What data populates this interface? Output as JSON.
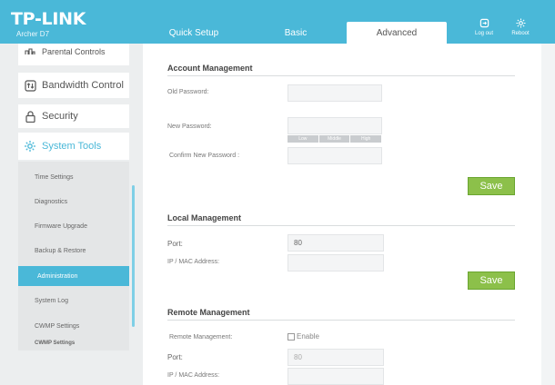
{
  "header": {
    "logo": "TP-LINK",
    "model": "Archer D7",
    "tabs": {
      "quick_setup": "Quick Setup",
      "basic": "Basic",
      "advanced": "Advanced"
    },
    "logout_label": "Log out",
    "reboot_label": "Reboot"
  },
  "sidebar": {
    "parental": "Parental Controls",
    "bandwidth": "Bandwidth Control",
    "security": "Security",
    "system_tools": "System Tools",
    "sub": [
      "Time Settings",
      "Diagnostics",
      "Firmware Upgrade",
      "Backup & Restore",
      "Administration",
      "System Log",
      "CWMP Settings",
      "CWMP Settings"
    ]
  },
  "account": {
    "title": "Account Management",
    "old_password": "Old Password:",
    "new_password": "New Password:",
    "strength": [
      "Low",
      "Middle",
      "High"
    ],
    "confirm": "Confirm New Password :",
    "save": "Save"
  },
  "local": {
    "title": "Local Management",
    "port_label": "Port:",
    "port_value": "80",
    "ip_label": "IP / MAC Address:",
    "save": "Save"
  },
  "remote": {
    "title": "Remote Management",
    "rm_label": "Remote Management:",
    "enable": "Enable",
    "port_label": "Port:",
    "port_value": "80",
    "ip_label": "IP / MAC Address:"
  },
  "colors": {
    "accent": "#4ab8d8",
    "save": "#8cc04a"
  }
}
